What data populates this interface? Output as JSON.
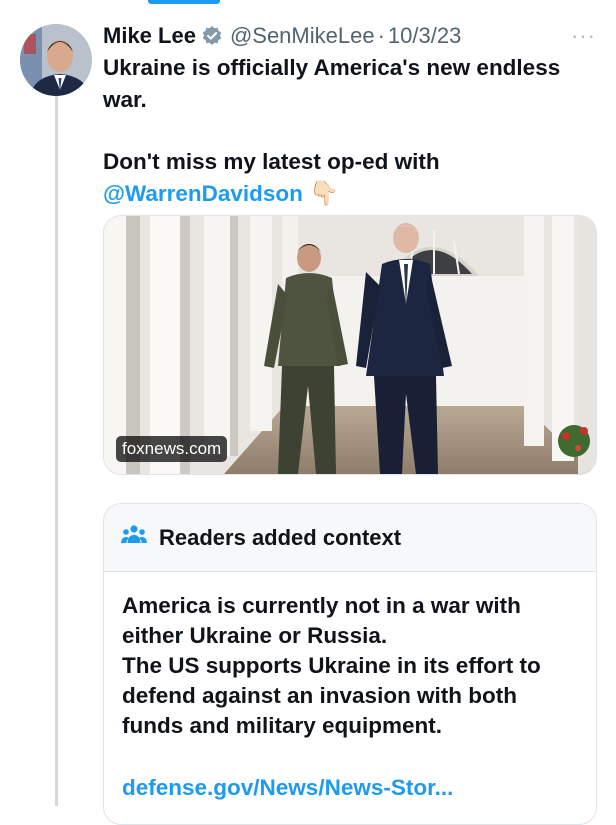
{
  "tweet": {
    "author_name": "Mike Lee",
    "handle": "@SenMikeLee",
    "separator": "·",
    "date": "10/3/23",
    "more_label": "···",
    "text_line1": "Ukraine is officially America's new endless war.",
    "text_line2": "Don't miss my latest op-ed with",
    "mention": "@WarrenDavidson",
    "mention_emoji": "👇🏻"
  },
  "media": {
    "source_label": "foxnews.com"
  },
  "community_note": {
    "title": "Readers added context",
    "line1": "America is currently not in a war with either Ukraine or Russia.",
    "line2": "The US supports Ukraine in its effort to defend against an invasion with both funds and military equipment.",
    "link_text": "defense.gov/News/News-Stor..."
  },
  "colors": {
    "accent": "#1d9bf0",
    "text": "#0f1419",
    "muted": "#536471",
    "border": "#dfe4e8"
  },
  "icons": [
    "verified-badge-icon",
    "more-options-icon",
    "readers-people-icon",
    "pointing-down-emoji"
  ]
}
